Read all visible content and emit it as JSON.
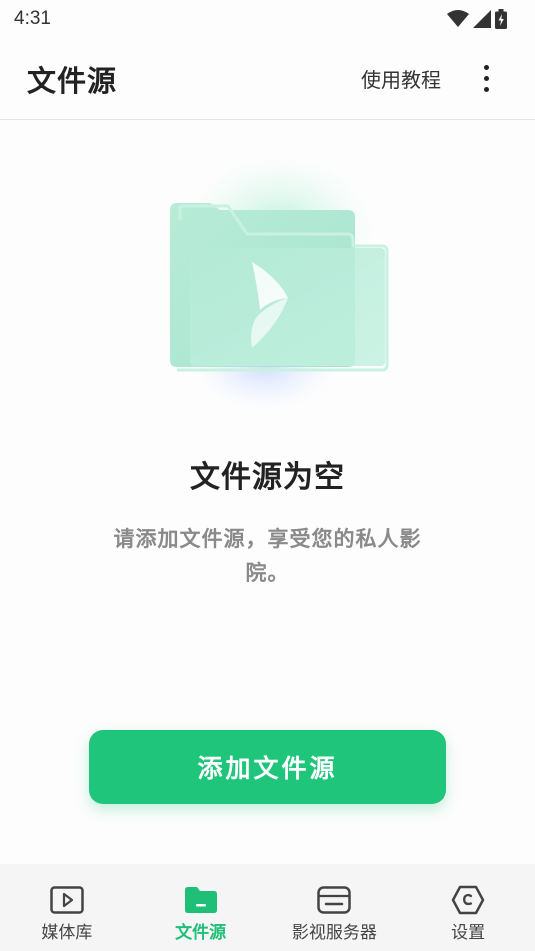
{
  "status_bar": {
    "time": "4:31",
    "icons": [
      "wifi-icon",
      "signal-icon",
      "battery-icon"
    ]
  },
  "app_bar": {
    "title": "文件源",
    "tutorial_label": "使用教程",
    "more_icon": "more-vertical-icon"
  },
  "empty_state": {
    "illustration": "folder-icon",
    "title": "文件源为空",
    "description": "请添加文件源，享受您的私人影院。",
    "add_button_label": "添加文件源"
  },
  "bottom_nav": {
    "active_index": 1,
    "items": [
      {
        "label": "媒体库",
        "icon": "media-library-icon"
      },
      {
        "label": "文件源",
        "icon": "folder-icon"
      },
      {
        "label": "影视服务器",
        "icon": "server-icon"
      },
      {
        "label": "设置",
        "icon": "settings-icon"
      }
    ]
  },
  "colors": {
    "accent": "#1fc57a",
    "accent_text": "#1fbf77",
    "background": "#fdfdfd",
    "nav_background": "#f5f5f5",
    "secondary_text": "#8a8a8a"
  }
}
